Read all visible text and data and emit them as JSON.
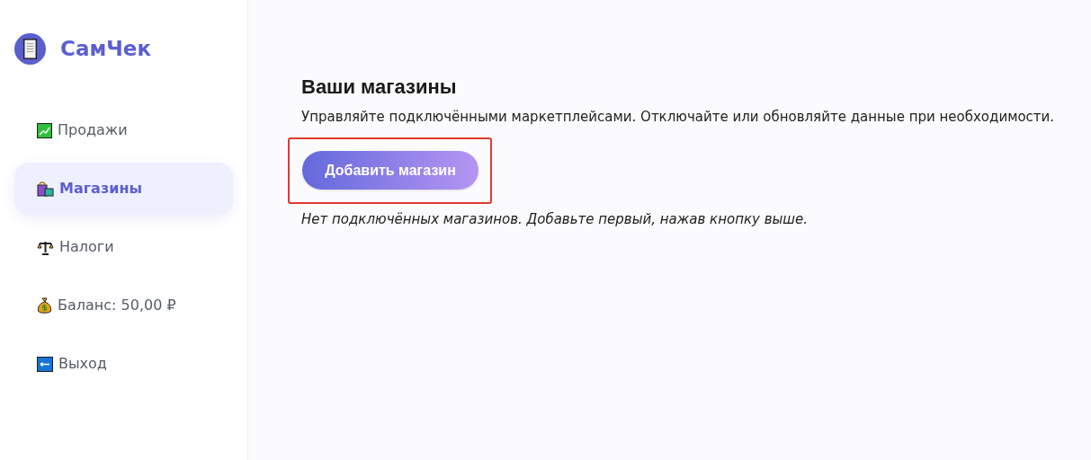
{
  "brand": {
    "name": "СамЧек"
  },
  "nav": [
    {
      "kind": "chart",
      "label": "Продажи",
      "selected": false
    },
    {
      "kind": "bags",
      "label": "Магазины",
      "selected": true
    },
    {
      "kind": "scales",
      "label": "Налоги",
      "selected": false
    },
    {
      "kind": "money",
      "label": "Баланс: 50,00 ₽",
      "selected": false
    },
    {
      "kind": "exit",
      "label": "Выход",
      "selected": false
    }
  ],
  "main": {
    "title": "Ваши магазины",
    "subtitle": "Управляйте подключёнными маркетплейсами. Отключайте или обновляйте данные при необходимости.",
    "add_button": {
      "label": "Добавить магазин",
      "highlighted": true
    },
    "empty_note": "Нет подключённых магазинов. Добавьте первый, нажав кнопку выше."
  }
}
